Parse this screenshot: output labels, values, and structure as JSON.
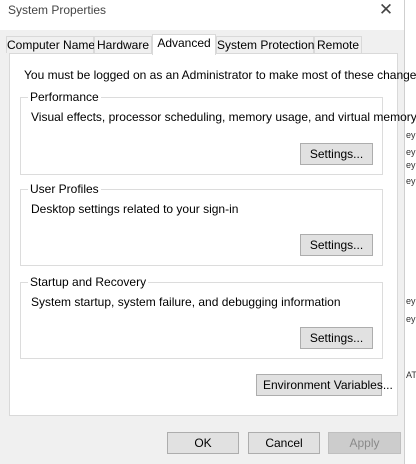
{
  "window": {
    "title": "System Properties",
    "close_label": "✕"
  },
  "tabs": [
    {
      "label": "Computer Name",
      "active": false
    },
    {
      "label": "Hardware",
      "active": false
    },
    {
      "label": "Advanced",
      "active": true
    },
    {
      "label": "System Protection",
      "active": false
    },
    {
      "label": "Remote",
      "active": false
    }
  ],
  "advanced": {
    "admin_note": "You must be logged on as an Administrator to make most of these changes.",
    "performance": {
      "title": "Performance",
      "description": "Visual effects, processor scheduling, memory usage, and virtual memory",
      "button": "Settings..."
    },
    "user_profiles": {
      "title": "User Profiles",
      "description": "Desktop settings related to your sign-in",
      "button": "Settings..."
    },
    "startup_recovery": {
      "title": "Startup and Recovery",
      "description": "System startup, system failure, and debugging information",
      "button": "Settings..."
    },
    "env_vars_button": "Environment Variables..."
  },
  "footer": {
    "ok": "OK",
    "cancel": "Cancel",
    "apply": "Apply",
    "apply_enabled": false
  },
  "background_fragments": [
    "ey",
    "ey",
    "ey",
    "ey",
    "ey",
    "ey",
    "AT"
  ]
}
